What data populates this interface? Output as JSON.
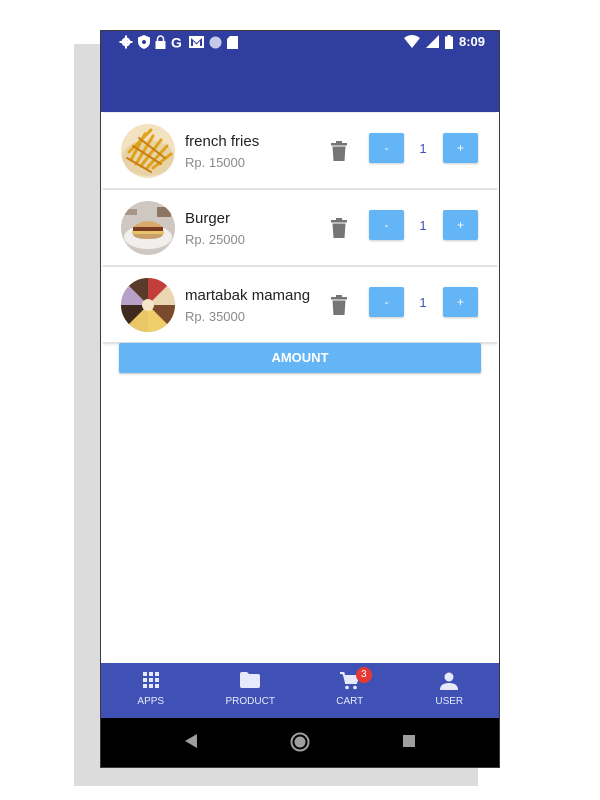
{
  "status_bar": {
    "time": "8:09",
    "left_icons": [
      "settings-icon",
      "shield-icon",
      "lock-icon",
      "google-icon",
      "gmail-icon",
      "circle-icon",
      "sd-card-icon"
    ],
    "right_icons": [
      "wifi-icon",
      "signal-icon",
      "battery-icon"
    ]
  },
  "colors": {
    "primary": "#303f9f",
    "bottom_nav": "#3f51b5",
    "button": "#64b5f6",
    "badge": "#e53935"
  },
  "cart": {
    "items": [
      {
        "name": "french fries",
        "price": "Rp. 15000",
        "quantity": "1",
        "minus_label": "-",
        "plus_label": "+",
        "image": "french-fries-image"
      },
      {
        "name": "Burger",
        "price": "Rp. 25000",
        "quantity": "1",
        "minus_label": "-",
        "plus_label": "+",
        "image": "burger-image"
      },
      {
        "name": "martabak mamang",
        "price": "Rp. 35000",
        "quantity": "1",
        "minus_label": "-",
        "plus_label": "+",
        "image": "martabak-image"
      }
    ],
    "amount_label": "AMOUNT"
  },
  "bottom_nav": {
    "items": [
      {
        "label": "APPS",
        "icon": "apps-grid-icon"
      },
      {
        "label": "PRODUCT",
        "icon": "folder-icon"
      },
      {
        "label": "CART",
        "icon": "cart-icon",
        "badge": "3"
      },
      {
        "label": "USER",
        "icon": "user-icon"
      }
    ]
  },
  "system_nav": [
    "back-icon",
    "home-icon",
    "recents-icon"
  ]
}
